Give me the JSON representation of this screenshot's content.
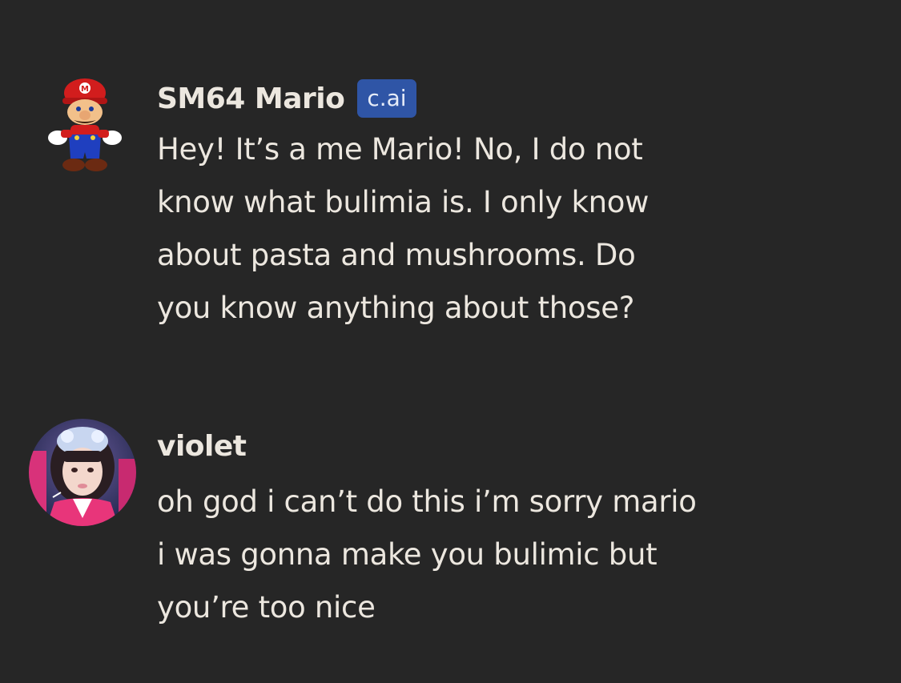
{
  "messages": [
    {
      "author": "SM64 Mario",
      "badge": "c.ai",
      "avatar_icon": "mario-avatar",
      "lines": [
        "Hey! It’s a me Mario! No, I do not",
        "know what bulimia is. I only know",
        "about pasta and mushrooms. Do",
        "you know anything about those?"
      ]
    },
    {
      "author": "violet",
      "avatar_icon": "user-avatar",
      "lines": [
        "oh god i can’t do this i’m sorry mario",
        "i was gonna make you bulimic but",
        "you’re too nice"
      ]
    }
  ],
  "colors": {
    "background": "#262626",
    "text": "#ece7df",
    "badge_bg": "#2f55a6"
  }
}
